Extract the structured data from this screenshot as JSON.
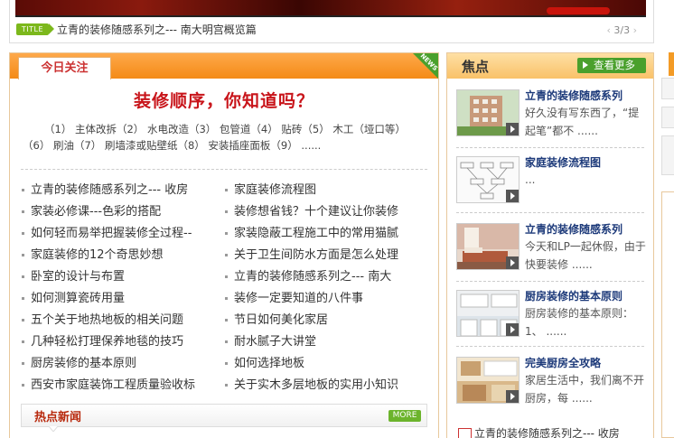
{
  "banner": {
    "title_tag": "TITLE",
    "caption": "立青的装修随感系列之--- 南大明宫概览篇",
    "pager": "3/3",
    "prev_icon": "chevron-left-icon",
    "next_icon": "chevron-right-icon"
  },
  "focus": {
    "tab_label": "今日关注",
    "corner_label": "NEWS",
    "headline": "装修顺序，你知道吗？",
    "steps_line1": "（1） 主体改拆（2） 水电改造（3） 包管道（4） 贴砖（5） 木工（垭口等）",
    "steps_line2": "（6） 刷油（7） 刷墙漆或贴壁纸（8） 安装插座面板（9） ......",
    "left_links": [
      "立青的装修随感系列之--- 收房",
      "家装必修课---色彩的搭配",
      "如何轻而易举把握装修全过程--",
      "家庭装修的12个奇思妙想",
      "卧室的设计与布置",
      "如何测算瓷砖用量",
      "五个关于地热地板的相关问题",
      "几种轻松打理保养地毯的技巧",
      "厨房装修的基本原则",
      "西安市家庭装饰工程质量验收标"
    ],
    "right_links": [
      "家庭装修流程图",
      "装修想省钱？十个建议让你装修",
      "家装隐蔽工程施工中的常用猫腻",
      "关于卫生间防水方面是怎么处理",
      "立青的装修随感系列之--- 南大",
      "装修一定要知道的八件事",
      "节日如何美化家居",
      "耐水腻子大讲堂",
      "如何选择地板",
      "关于实木多层地板的实用小知识"
    ],
    "hot_news_title": "热点新闻",
    "more_label": "MORE"
  },
  "hot": {
    "title": "焦点",
    "see_more": "查看更多",
    "items": [
      {
        "title": "立青的装修随感系列",
        "desc": "好久没有写东西了，“提起笔”都不 ......",
        "thumb": "building"
      },
      {
        "title": "家庭装修流程图",
        "desc": "...",
        "thumb": "flowchart"
      },
      {
        "title": "立青的装修随感系列",
        "desc": "今天和LP一起休假，由于快要装修 ......",
        "thumb": "bedroom"
      },
      {
        "title": "厨房装修的基本原则",
        "desc": "厨房装修的基本原则： 1、 ......",
        "thumb": "kitchen"
      },
      {
        "title": "完美厨房全攻略",
        "desc": "家居生活中，我们离不开厨房，每 ......",
        "thumb": "kitchen2"
      }
    ],
    "last_link": "立青的装修随感系列之--- 收房"
  },
  "colors": {
    "accent_orange": "#f48a16",
    "headline_red": "#c8141a",
    "green_button": "#4aa02c",
    "link_blue": "#1d3a7a"
  }
}
